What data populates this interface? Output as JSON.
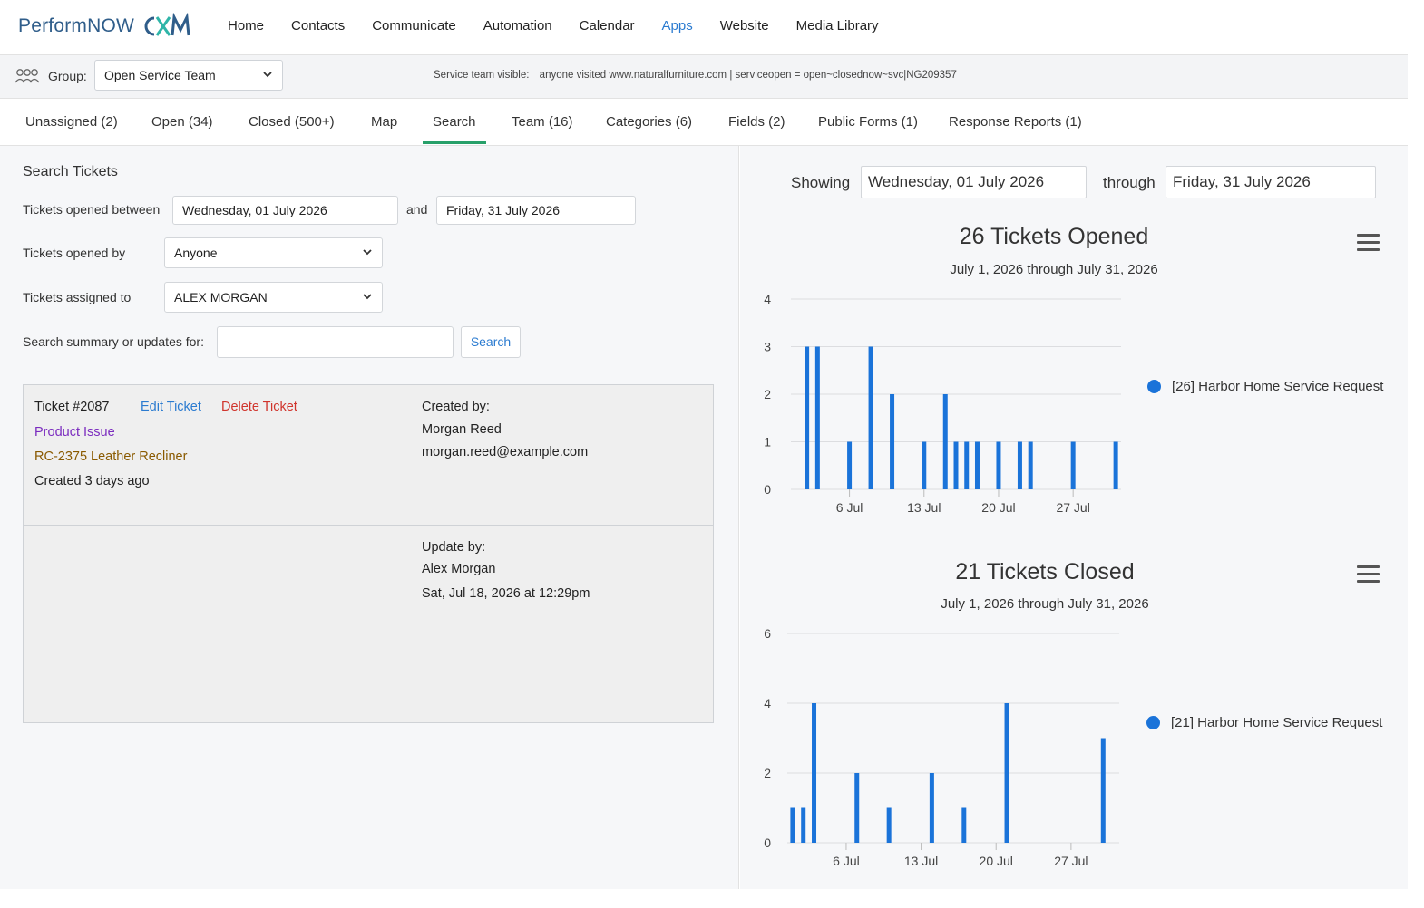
{
  "brand": {
    "name_a": "Perform",
    "name_b": "NOW",
    "mark": "CXM"
  },
  "nav": [
    {
      "label": "Home",
      "active": false
    },
    {
      "label": "Contacts",
      "active": false
    },
    {
      "label": "Communicate",
      "active": false
    },
    {
      "label": "Automation",
      "active": false
    },
    {
      "label": "Calendar",
      "active": false
    },
    {
      "label": "Apps",
      "active": true
    },
    {
      "label": "Website",
      "active": false
    },
    {
      "label": "Media Library",
      "active": false
    }
  ],
  "group": {
    "label": "Group:",
    "value": "Open Service Team",
    "note_label": "Service team visible:",
    "note_value": "anyone visited www.naturalfurniture.com | serviceopen = open~closednow~svc|NG209357"
  },
  "tabs": [
    {
      "label": "Unassigned (2)"
    },
    {
      "label": "Open (34)"
    },
    {
      "label": "Closed (500+)"
    },
    {
      "label": "Map"
    },
    {
      "label": "Search"
    },
    {
      "label": "Team (16)"
    },
    {
      "label": "Categories (6)"
    },
    {
      "label": "Fields (2)"
    },
    {
      "label": "Public Forms (1)"
    },
    {
      "label": "Response Reports (1)"
    }
  ],
  "active_tab": "Search",
  "search": {
    "heading": "Search Tickets",
    "opened_between_label": "Tickets opened between",
    "from_date": "Wednesday, 01 July 2026",
    "and_label": "and",
    "to_date": "Friday, 31 July 2026",
    "opened_by_label": "Tickets opened by",
    "opened_by_value": "Anyone",
    "assigned_to_label": "Tickets assigned to",
    "assigned_to_value": "ALEX MORGAN",
    "summary_label": "Search summary or updates for:",
    "summary_value": "",
    "search_button": "Search"
  },
  "ticket": {
    "number": "Ticket #2087",
    "edit": "Edit Ticket",
    "delete": "Delete Ticket",
    "category": "Product Issue",
    "product": "RC-2375 Leather Recliner",
    "created_ago": "Created 3 days ago",
    "created_by_label": "Created by:",
    "created_by_name": "Morgan Reed",
    "created_by_email": "morgan.reed@example.com",
    "update_by_label": "Update by:",
    "update_by_name": "Alex Morgan",
    "update_time": "Sat, Jul 18, 2026 at 12:29pm"
  },
  "range": {
    "showing_label": "Showing",
    "from": "Wednesday, 01 July 2026",
    "through_label": "through",
    "to": "Friday, 31 July 2026"
  },
  "colors": {
    "accent": "#2b7bd0",
    "bar": "#1a73d9",
    "tab_active": "#28a06a",
    "delete": "#d0342c"
  },
  "chart_data": [
    {
      "type": "bar",
      "title": "26 Tickets Opened",
      "subtitle": "July 1, 2026 through July 31, 2026",
      "x_ticks": [
        "6 Jul",
        "13 Jul",
        "20 Jul",
        "27 Jul"
      ],
      "ylim": [
        0,
        4
      ],
      "y_ticks": [
        0,
        1,
        2,
        3,
        4
      ],
      "grid": true,
      "legend": "right",
      "series": [
        {
          "name": "[26] Harbor Home Service Request",
          "x": [
            2,
            3,
            6,
            8,
            10,
            13,
            15,
            16,
            17,
            18,
            20,
            22,
            23,
            27,
            31
          ],
          "values": [
            3,
            3,
            1,
            3,
            2,
            1,
            2,
            1,
            1,
            1,
            1,
            1,
            1,
            1,
            1
          ]
        }
      ]
    },
    {
      "type": "bar",
      "title": "21 Tickets Closed",
      "subtitle": "July 1, 2026 through July 31, 2026",
      "x_ticks": [
        "6 Jul",
        "13 Jul",
        "20 Jul",
        "27 Jul"
      ],
      "ylim": [
        0,
        6
      ],
      "y_ticks": [
        0,
        2,
        4,
        6
      ],
      "grid": true,
      "legend": "right",
      "series": [
        {
          "name": "[21] Harbor Home Service Request",
          "x": [
            1,
            2,
            3,
            7,
            10,
            14,
            17,
            21,
            30
          ],
          "values": [
            1,
            1,
            4,
            2,
            1,
            2,
            1,
            4,
            3
          ]
        }
      ]
    }
  ]
}
